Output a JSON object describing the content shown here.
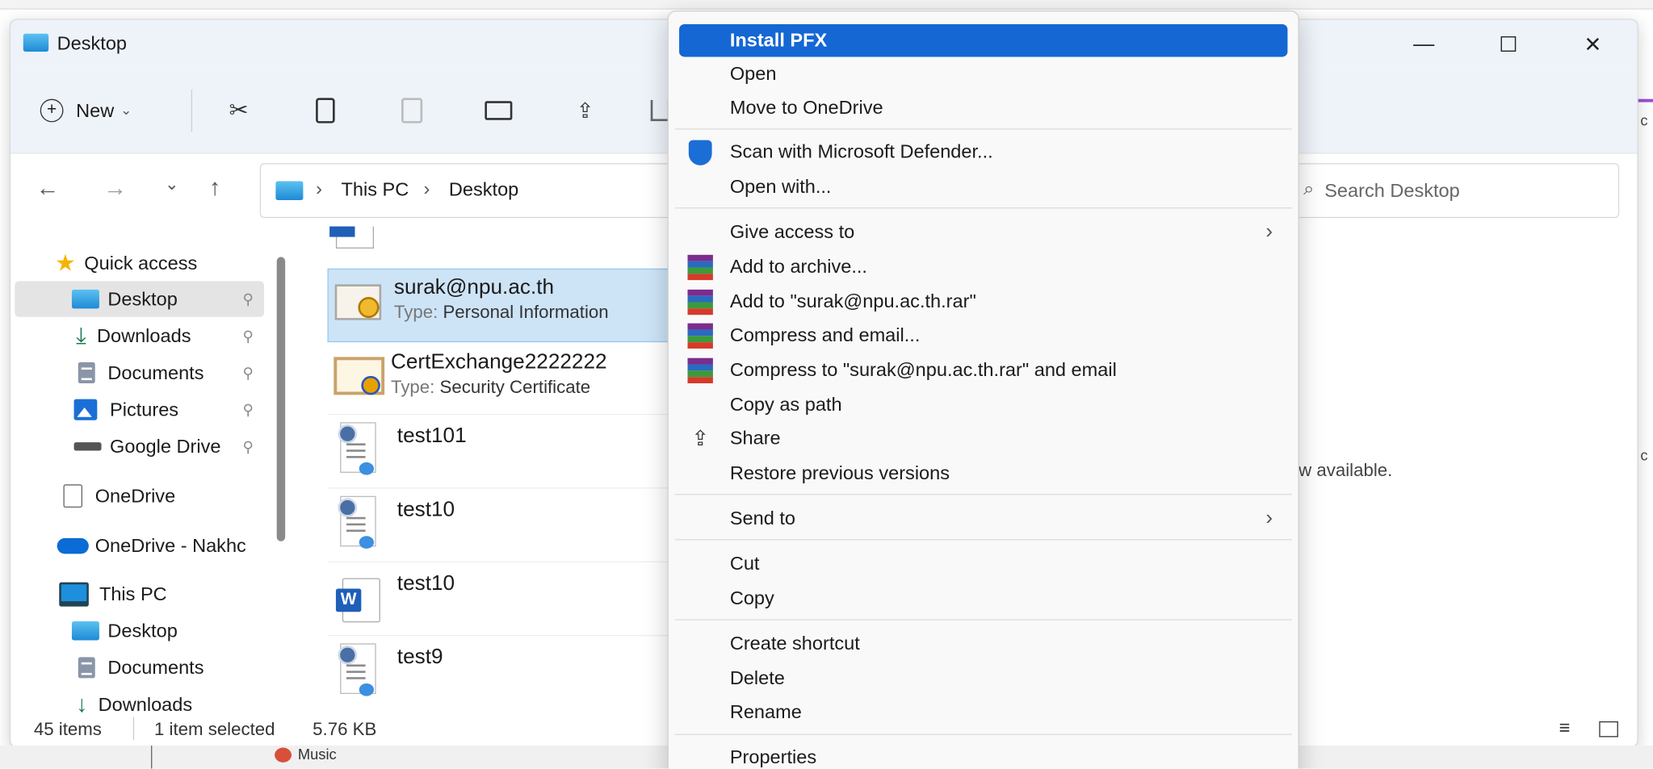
{
  "window": {
    "title": "Desktop",
    "controls": {
      "minimize": "—",
      "maximize": "☐",
      "close": "✕"
    }
  },
  "ribbon": {
    "new_label": "New",
    "new_chevron": "⌄",
    "icons": [
      "cut-icon",
      "copy-icon",
      "paste-icon",
      "rename-icon",
      "share-icon",
      "delete-icon"
    ]
  },
  "address": {
    "crumbs": [
      "This PC",
      "Desktop"
    ],
    "separator": "›",
    "search_placeholder": "Search Desktop"
  },
  "sidebar": {
    "items": [
      {
        "label": "Quick access",
        "icon": "star-icon"
      },
      {
        "label": "Desktop",
        "icon": "folder-desktop-icon",
        "selected": true,
        "pinned": true
      },
      {
        "label": "Downloads",
        "icon": "download-icon",
        "pinned": true
      },
      {
        "label": "Documents",
        "icon": "documents-icon",
        "pinned": true
      },
      {
        "label": "Pictures",
        "icon": "pictures-icon",
        "pinned": true
      },
      {
        "label": "Google Drive",
        "icon": "drive-icon",
        "pinned": true
      },
      {
        "label": "OneDrive",
        "icon": "page-icon"
      },
      {
        "label": "OneDrive - Nakhc",
        "icon": "cloud-icon"
      },
      {
        "label": "This PC",
        "icon": "pc-icon"
      },
      {
        "label": "Desktop",
        "icon": "folder-desktop-icon"
      },
      {
        "label": "Documents",
        "icon": "documents-icon"
      },
      {
        "label": "Downloads",
        "icon": "download-icon"
      }
    ],
    "pin_glyph": "📌"
  },
  "files": [
    {
      "name": "surak@npu.ac.th",
      "type_label": "Type:",
      "type_value": "Personal Information",
      "selected": true,
      "icon": "pfx-icon"
    },
    {
      "name": "CertExchange2222222",
      "type_label": "Type:",
      "type_value": "Security Certificate",
      "icon": "certificate-icon"
    },
    {
      "name": "test101",
      "icon": "wizard-doc-icon"
    },
    {
      "name": "test10",
      "icon": "wizard-doc-icon"
    },
    {
      "name": "test10",
      "icon": "word-doc-icon"
    },
    {
      "name": "test9",
      "icon": "wizard-doc-icon"
    }
  ],
  "preview_text": "ew available.",
  "status": {
    "items": "45 items",
    "selected": "1 item selected",
    "size": "5.76 KB"
  },
  "background": {
    "music_label": "Music"
  },
  "context_menu": {
    "items": [
      {
        "label": "Install PFX",
        "highlighted": true
      },
      {
        "label": "Open"
      },
      {
        "label": "Move to OneDrive"
      },
      {
        "label": "Scan with Microsoft Defender...",
        "icon": "defender-shield-icon"
      },
      {
        "label": "Open with..."
      },
      {
        "label": "Give access to",
        "submenu": true
      },
      {
        "label": "Add to archive...",
        "icon": "winrar-icon"
      },
      {
        "label": "Add to \"surak@npu.ac.th.rar\"",
        "icon": "winrar-icon"
      },
      {
        "label": "Compress and email...",
        "icon": "winrar-icon"
      },
      {
        "label": "Compress to \"surak@npu.ac.th.rar\" and email",
        "icon": "winrar-icon"
      },
      {
        "label": "Copy as path"
      },
      {
        "label": "Share",
        "icon": "share-icon"
      },
      {
        "label": "Restore previous versions"
      },
      {
        "label": "Send to",
        "submenu": true
      },
      {
        "label": "Cut"
      },
      {
        "label": "Copy"
      },
      {
        "label": "Create shortcut"
      },
      {
        "label": "Delete"
      },
      {
        "label": "Rename"
      },
      {
        "label": "Properties"
      }
    ],
    "submenu_glyph": "›"
  },
  "colors": {
    "accent": "#1567d3",
    "selection": "#cde4f7"
  }
}
